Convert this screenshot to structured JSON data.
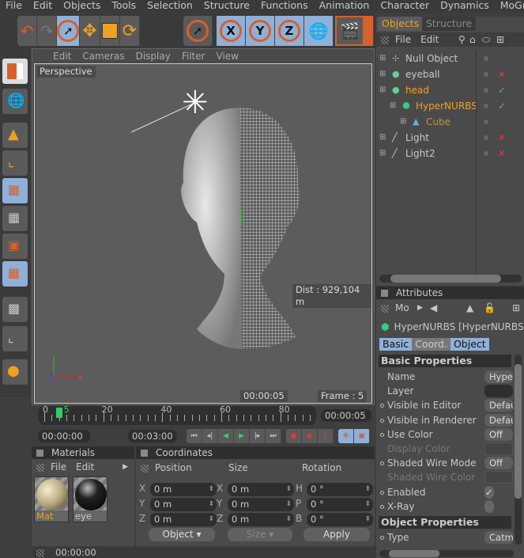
{
  "menu": [
    "File",
    "Edit",
    "Objects",
    "Tools",
    "Selection",
    "Structure",
    "Functions",
    "Animation",
    "Character",
    "Dynamics",
    "MoGra"
  ],
  "toolbar": {
    "icons": [
      "undo-icon",
      "redo-icon",
      "live-selection-icon",
      "move-icon",
      "scale-icon",
      "rotate-icon",
      "selection-tool-icon",
      "x-axis-icon",
      "y-axis-icon",
      "z-axis-icon",
      "world-coordinates-icon",
      "render-view-icon",
      "render-picture-icon"
    ],
    "x": "X",
    "y": "Y",
    "z": "Z"
  },
  "viewport": {
    "menu": [
      "Edit",
      "Cameras",
      "Display",
      "Filter",
      "View"
    ],
    "camera": "Perspective",
    "dist": "Dist : 929,104 m",
    "time": "00:00:05",
    "frame": "Frame : 5"
  },
  "timeline": {
    "labels": [
      "0",
      "5",
      "20",
      "40",
      "60",
      "80"
    ],
    "current_time": "00:00:05",
    "start": "00:00:00",
    "end": "00:03:00",
    "current_frame": 5,
    "max_frame": 90
  },
  "materials": {
    "title": "Materials",
    "menu": [
      "File",
      "Edit"
    ],
    "items": [
      {
        "name": "Mat",
        "color": "#e0d2a8"
      },
      {
        "name": "eye",
        "color": "#202020"
      }
    ]
  },
  "coordinates": {
    "title": "Coordinates",
    "headers": [
      "Position",
      "Size",
      "Rotation"
    ],
    "rows": [
      {
        "pl": "X",
        "pv": "0 m",
        "sl": "X",
        "sv": "0 m",
        "rl": "H",
        "rv": "0 °"
      },
      {
        "pl": "Y",
        "pv": "0 m",
        "sl": "Y",
        "sv": "0 m",
        "rl": "P",
        "rv": "0 °"
      },
      {
        "pl": "Z",
        "pv": "0 m",
        "sl": "Z",
        "sv": "0 m",
        "rl": "B",
        "rv": "0 °"
      }
    ],
    "mode": "Object",
    "size_mode": "Size",
    "apply": "Apply"
  },
  "status": "00:00:00",
  "objects": {
    "tabs": [
      "Objects",
      "Structure"
    ],
    "menu": [
      "File",
      "Edit"
    ],
    "items": [
      {
        "name": "Null Object",
        "indent": 0,
        "color": "#c8c8c8",
        "flag": ""
      },
      {
        "name": "eyeball",
        "indent": 0,
        "color": "#c8c8c8",
        "flag": "x"
      },
      {
        "name": "head",
        "indent": 0,
        "color": "#f0a020",
        "flag": "check"
      },
      {
        "name": "HyperNURBS",
        "indent": 1,
        "color": "#f0a020",
        "flag": "check"
      },
      {
        "name": "Cube",
        "indent": 2,
        "color": "#c89030",
        "flag": ""
      },
      {
        "name": "Light",
        "indent": 0,
        "color": "#c8c8c8",
        "flag": "x"
      },
      {
        "name": "Light2",
        "indent": 0,
        "color": "#c8c8c8",
        "flag": "x"
      }
    ]
  },
  "attributes": {
    "title": "Attributes",
    "mode": "Mo",
    "object": "HyperNURBS [HyperNURBS]",
    "tabs": [
      "Basic",
      "Coord.",
      "Object"
    ],
    "section1": "Basic Properties",
    "rows": [
      {
        "name": "Name",
        "value": "HyperNURBS",
        "bullet": false,
        "dim": false
      },
      {
        "name": "Layer",
        "value": "",
        "bullet": false,
        "dim": false
      },
      {
        "name": "Visible in Editor",
        "value": "Default",
        "bullet": true,
        "dim": false
      },
      {
        "name": "Visible in Renderer",
        "value": "Default",
        "bullet": true,
        "dim": false
      },
      {
        "name": "Use Color",
        "value": "Off",
        "bullet": true,
        "dim": false
      },
      {
        "name": "Display Color",
        "value": "",
        "bullet": false,
        "dim": true
      },
      {
        "name": "Shaded Wire Mode",
        "value": "Off",
        "bullet": true,
        "dim": false
      },
      {
        "name": "Shaded Wire Color",
        "value": "",
        "bullet": false,
        "dim": true
      },
      {
        "name": "Enabled",
        "value": "✓",
        "bullet": true,
        "dim": false
      },
      {
        "name": "X-Ray",
        "value": "",
        "bullet": true,
        "dim": false
      }
    ],
    "section2": "Object Properties",
    "rows2": [
      {
        "name": "Type",
        "value": "Catmull-Clark",
        "bullet": true
      }
    ]
  },
  "colors": {
    "accent": "#8fb0d8",
    "orange": "#f0a020",
    "selection_ring": "#d8602a"
  }
}
